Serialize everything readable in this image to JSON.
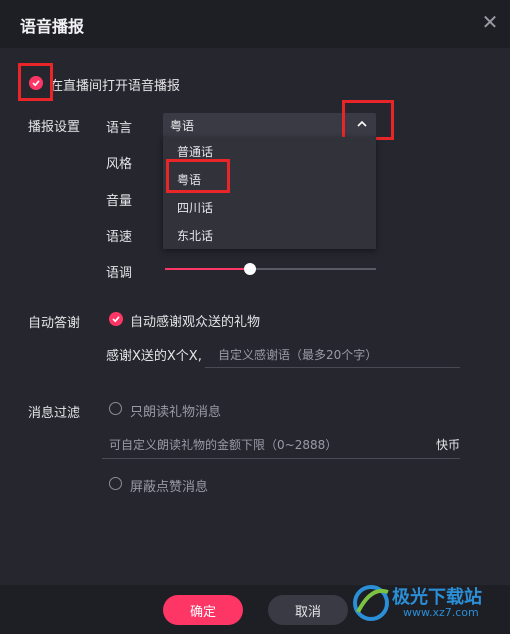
{
  "dialog": {
    "title": "语音播报"
  },
  "voice": {
    "enable_label": "在直播间打开语音播报",
    "enable_checked": true,
    "section_label": "播报设置",
    "language_label": "语言",
    "language_value": "粤语",
    "language_options": [
      "普通话",
      "粤语",
      "四川话",
      "东北话"
    ],
    "style_label": "风格",
    "volume_label": "音量",
    "speed_label": "语速",
    "pitch_label": "语调",
    "pitch_level": 0.41
  },
  "auto_thanks": {
    "section_label": "自动答谢",
    "checkbox_label": "自动感谢观众送的礼物",
    "checked": true,
    "template_prefix": "感谢X送的X个X,",
    "input_placeholder": "自定义感谢语（最多20个字）"
  },
  "filter": {
    "section_label": "消息过滤",
    "gift_only_label": "只朗读礼物消息",
    "gift_input_placeholder": "可自定义朗读礼物的金额下限（0~2888）",
    "currency_label": "快币",
    "block_likes_label": "屏蔽点赞消息"
  },
  "footer": {
    "confirm_label": "确定",
    "cancel_label": "取消"
  },
  "watermark": {
    "text": "极光下载站",
    "url": "www.xz7.com"
  },
  "colors": {
    "accent": "#fe3666",
    "highlight_box": "#e8262a"
  }
}
